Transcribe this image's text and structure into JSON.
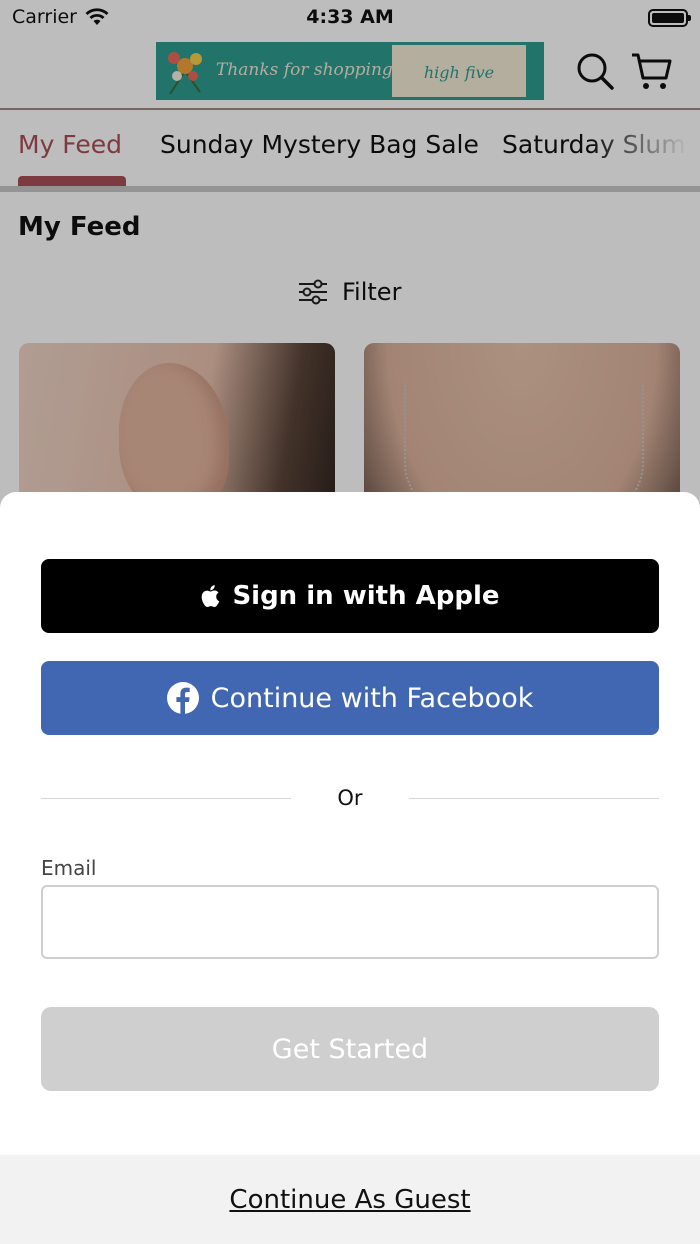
{
  "status_bar": {
    "carrier": "Carrier",
    "time": "4:33 AM"
  },
  "header": {
    "banner_text": "Thanks for shopping!",
    "banner_logo_text": "high five"
  },
  "tabs": [
    {
      "label": "My Feed",
      "active": true
    },
    {
      "label": "Sunday Mystery Bag Sale",
      "active": false
    },
    {
      "label": "Saturday Slump",
      "active": false
    }
  ],
  "feed": {
    "title": "My Feed",
    "filter_label": "Filter"
  },
  "sign_in": {
    "apple_label": "Sign in with Apple",
    "facebook_label": "Continue with Facebook",
    "or_label": "Or",
    "email_label": "Email",
    "email_value": "",
    "get_started_label": "Get Started",
    "guest_label": "Continue As Guest"
  },
  "colors": {
    "accent": "#a94f58",
    "facebook": "#4267b2",
    "apple": "#000000",
    "disabled_button": "#cfcfcf",
    "banner": "#2e9c8e"
  }
}
